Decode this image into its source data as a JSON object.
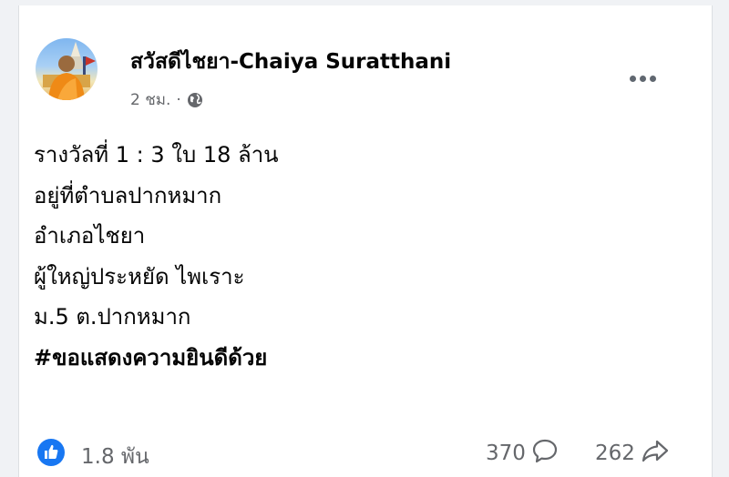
{
  "post": {
    "page_name": "สวัสดีไชยา-Chaiya Suratthani",
    "timestamp": "2 ชม.",
    "separator": "·",
    "privacy_icon": "globe-icon",
    "more_icon": "more-options-icon",
    "lines": [
      "รางวัลที่ 1 : 3 ใบ 18 ล้าน",
      "อยู่ที่ตำบลปากหมาก",
      "อำเภอไชยา",
      "ผู้ใหญ่ประหยัด ไพเราะ",
      "ม.5 ต.ปากหมาก"
    ],
    "hashtag": "#ขอแสดงความยินดีด้วย"
  },
  "footer": {
    "reaction_icon": "like-icon",
    "reaction_count": "1.8 พัน",
    "comment_count": "370",
    "comment_icon": "comment-icon",
    "share_count": "262",
    "share_icon": "share-icon"
  },
  "colors": {
    "like_blue": "#1877f2",
    "secondary_text": "#65676b",
    "primary_text": "#050505"
  }
}
